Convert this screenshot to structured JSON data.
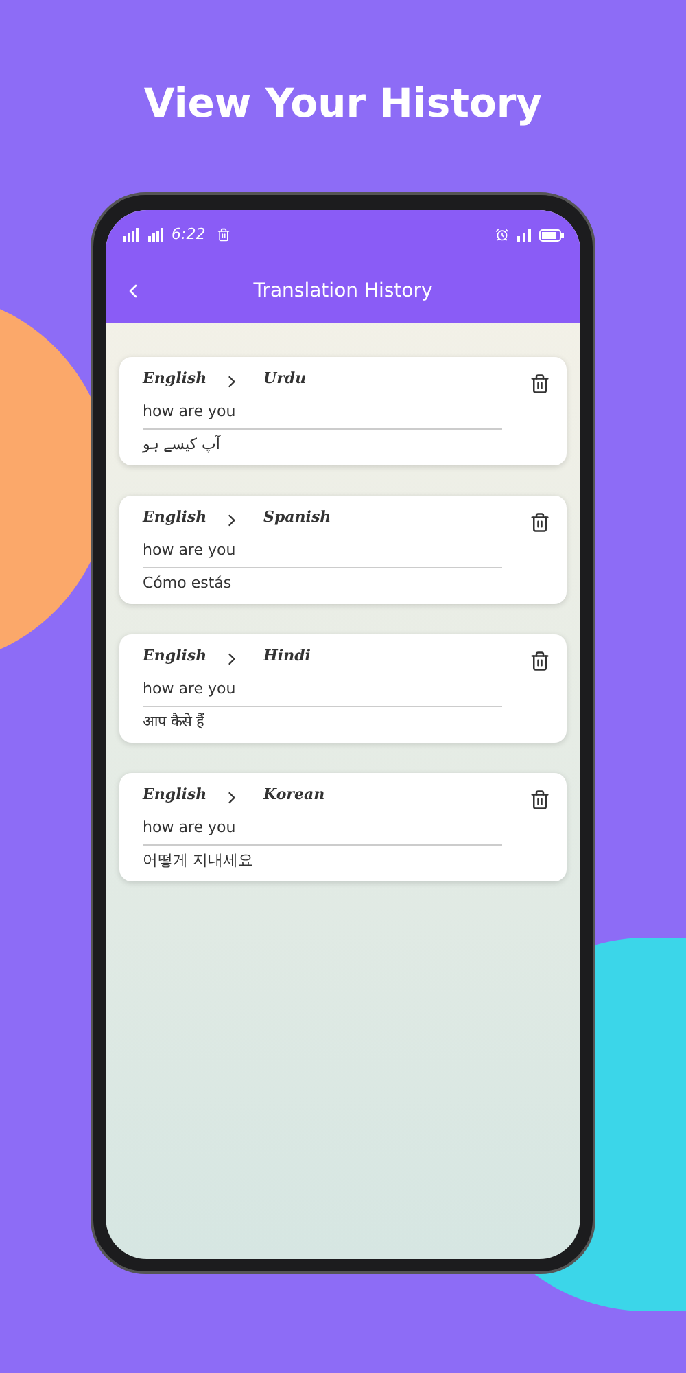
{
  "headline": "View Your History",
  "status_bar": {
    "time": "6:22"
  },
  "header": {
    "title": "Translation History"
  },
  "history": [
    {
      "source_language": "English",
      "target_language": "Urdu",
      "source_text": "how are you",
      "translated_text": "آپ کیسے ہو"
    },
    {
      "source_language": "English",
      "target_language": "Spanish",
      "source_text": "how are you",
      "translated_text": "Cómo estás"
    },
    {
      "source_language": "English",
      "target_language": "Hindi",
      "source_text": "how are you",
      "translated_text": "आप कैसे हैं"
    },
    {
      "source_language": "English",
      "target_language": "Korean",
      "source_text": "how are you",
      "translated_text": "어떻게 지내세요"
    }
  ]
}
